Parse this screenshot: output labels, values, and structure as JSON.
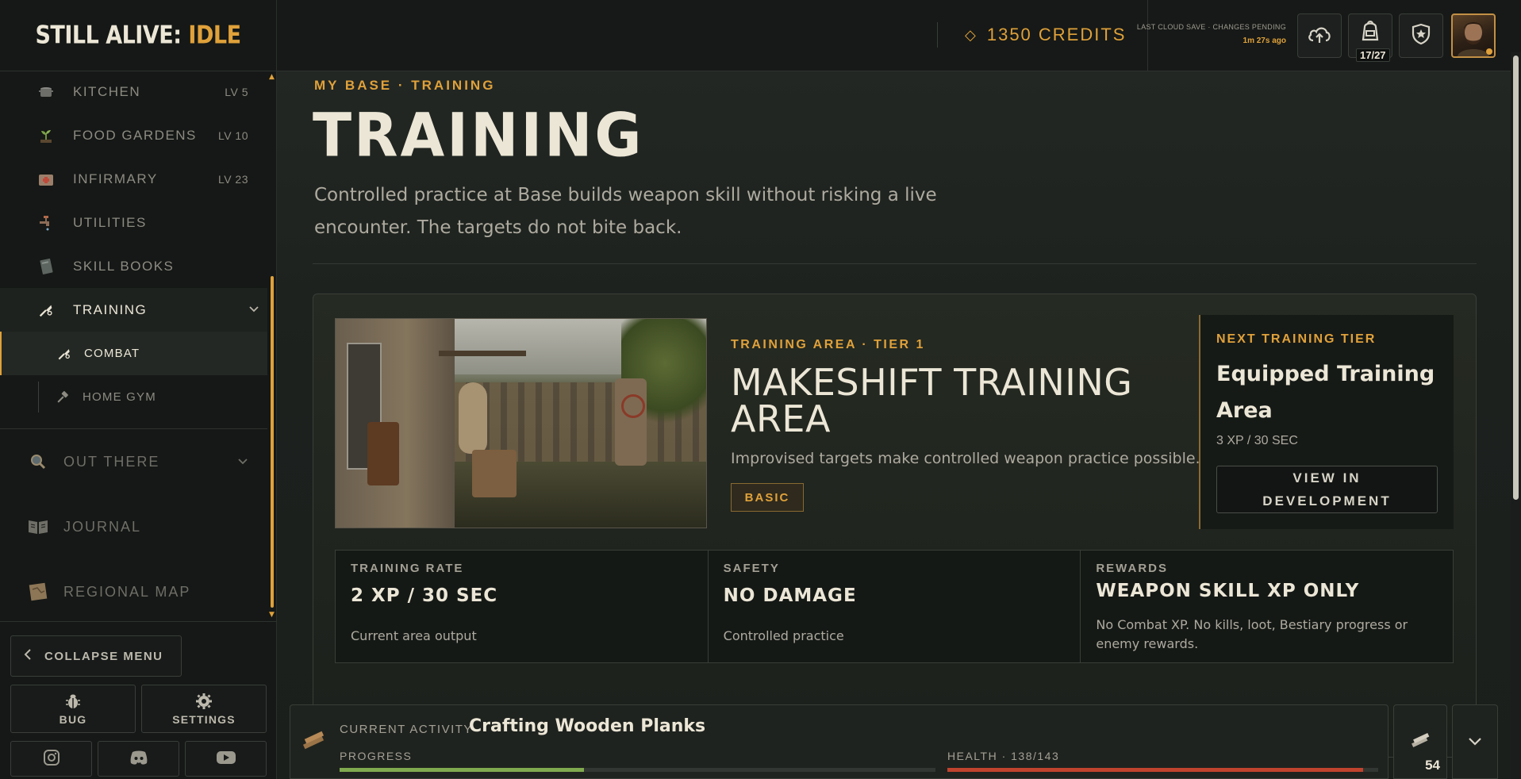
{
  "app": {
    "logo_main": "STILL ALIVE:",
    "logo_accent": "IDLE"
  },
  "topbar": {
    "credits_label": "1350 CREDITS",
    "save_status": "LAST CLOUD SAVE · CHANGES PENDING",
    "save_time": "1m 27s ago",
    "backpack_count": "17/27"
  },
  "sidebar": {
    "items": [
      {
        "label": "KITCHEN",
        "level": "LV 5"
      },
      {
        "label": "FOOD GARDENS",
        "level": "LV 10"
      },
      {
        "label": "INFIRMARY",
        "level": "LV 23"
      },
      {
        "label": "UTILITIES"
      },
      {
        "label": "SKILL BOOKS"
      },
      {
        "label": "TRAINING"
      }
    ],
    "subitems": [
      {
        "label": "COMBAT"
      },
      {
        "label": "HOME GYM"
      }
    ],
    "groups": [
      {
        "label": "OUT THERE"
      },
      {
        "label": "JOURNAL"
      },
      {
        "label": "REGIONAL MAP"
      }
    ],
    "collapse_label": "COLLAPSE MENU",
    "bug_label": "BUG",
    "settings_label": "SETTINGS"
  },
  "main": {
    "breadcrumb": "MY BASE · TRAINING",
    "title": "TRAINING",
    "description": "Controlled practice at Base builds weapon skill without risking a live encounter. The targets do not bite back."
  },
  "area": {
    "tag": "TRAINING AREA · TIER 1",
    "name": "MAKESHIFT TRAINING AREA",
    "description": "Improvised targets make controlled weapon practice possible.",
    "badge": "BASIC"
  },
  "next_tier": {
    "label": "NEXT TRAINING TIER",
    "name": "Equipped Training Area",
    "rate": "3 XP / 30 SEC",
    "button": "VIEW IN DEVELOPMENT"
  },
  "stats": [
    {
      "label": "TRAINING RATE",
      "value": "2 XP / 30 SEC",
      "desc": "Current area output"
    },
    {
      "label": "SAFETY",
      "value": "NO DAMAGE",
      "desc": "Controlled practice"
    },
    {
      "label": "REWARDS",
      "value": "WEAPON SKILL XP ONLY",
      "desc": "No Combat XP. No kills, loot, Bestiary progress or enemy rewards."
    }
  ],
  "activity": {
    "label": "CURRENT ACTIVITY",
    "name": "Crafting Wooden Planks",
    "progress_label": "PROGRESS",
    "progress": 0.41,
    "health_label": "HEALTH · 138/143",
    "health": 0.965,
    "inventory_count": "54"
  },
  "colors": {
    "accent": "#e0a13a",
    "progress": "#7faa4e",
    "health": "#c0432e"
  }
}
